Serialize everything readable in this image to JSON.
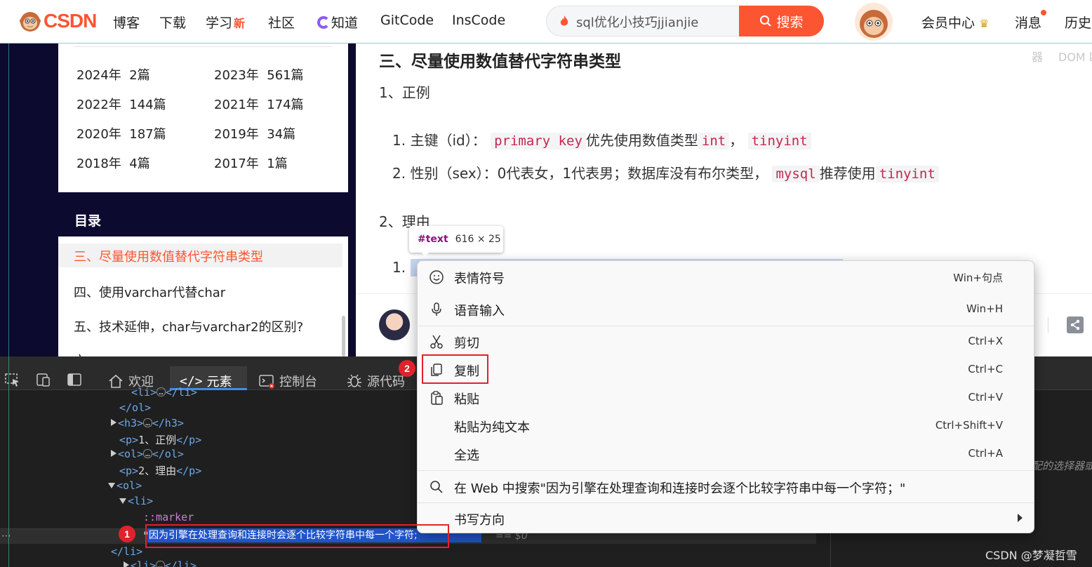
{
  "brand": {
    "logo_text": "CSDN"
  },
  "nav": {
    "items": [
      "博客",
      "下载",
      "学习",
      "社区",
      "知道",
      "GitCode",
      "InsCode"
    ],
    "new_badge": "新",
    "search_value": "sql优化小技巧jjianjie",
    "search_button": "搜索",
    "vip_center": "会员中心",
    "messages": "消息",
    "history": "历史"
  },
  "sidebar": {
    "archive": [
      {
        "year": "2024年",
        "count": "2篇"
      },
      {
        "year": "2023年",
        "count": "561篇"
      },
      {
        "year": "2022年",
        "count": "144篇"
      },
      {
        "year": "2021年",
        "count": "174篇"
      },
      {
        "year": "2020年",
        "count": "187篇"
      },
      {
        "year": "2019年",
        "count": "34篇"
      },
      {
        "year": "2018年",
        "count": "4篇"
      },
      {
        "year": "2017年",
        "count": "1篇"
      }
    ],
    "toc_title": "目录",
    "toc_items": [
      "三、尽量使用数值替代字符串类型",
      "四、使用varchar代替char",
      "五、技术延伸，char与varchar2的区别?",
      "六、..."
    ]
  },
  "article": {
    "heading": "三、尽量使用数值替代字符串类型",
    "p1": "1、正例",
    "li1": {
      "num": "1.",
      "pre": "主键（id）：",
      "code1": "primary key",
      "mid": "优先使用数值类型",
      "code2": "int",
      "sep": "，",
      "code3": "tinyint"
    },
    "li2": {
      "num": "2.",
      "pre": "性别（sex）：0代表女，1代表男；数据库没有布尔类型，",
      "code1": "mysql",
      "mid": "推荐使用",
      "code2": "tinyint"
    },
    "p2": "2、理由",
    "li3_num": "1."
  },
  "tooltip": {
    "tag": "#text",
    "dims": "616 × 25"
  },
  "context_menu": {
    "items": [
      {
        "label": "表情符号",
        "shortcut": "Win+句点"
      },
      {
        "label": "语音输入",
        "shortcut": "Win+H"
      },
      {
        "label": "剪切",
        "shortcut": "Ctrl+X"
      },
      {
        "label": "复制",
        "shortcut": "Ctrl+C"
      },
      {
        "label": "粘贴",
        "shortcut": "Ctrl+V"
      },
      {
        "label": "粘贴为纯文本",
        "shortcut": "Ctrl+Shift+V"
      },
      {
        "label": "全选",
        "shortcut": "Ctrl+A"
      },
      {
        "label": "在 Web 中搜索\"因为引擎在处理查询和连接时会逐个比较字符串中每一个字符；\"",
        "shortcut": ""
      },
      {
        "label": "书写方向",
        "shortcut": ""
      }
    ]
  },
  "devtools": {
    "tabs": [
      "欢迎",
      "元素",
      "控制台",
      "源代码"
    ],
    "dom_lines": {
      "ol_close": "</ol>",
      "h3": "<h3>",
      "h3_close": "</h3>",
      "p1_open": "<p>",
      "p1_text": "1、正例",
      "p1_close": "</p>",
      "ol2": "<ol>",
      "ol2_close": "</ol>",
      "p2_open": "<p>",
      "p2_text": "2、理由",
      "p2_close": "</p>",
      "ol3": "<ol>",
      "li": "<li>",
      "marker": "::marker",
      "selected_text": "因为引擎在处理查询和连接时会逐个比较字符串中每一个字符;",
      "eq_dollar": "== $0",
      "li_close": "</li>",
      "li_next": "<li>",
      "li_next_close": "</li>"
    },
    "right_tab_partial": "器",
    "right_tab_dom": "DOM 断",
    "right_filter": "配的选择器或",
    "ellipsis": "…",
    "quote": "\""
  },
  "annotations": {
    "step1": "1",
    "step2": "2"
  },
  "watermark": "CSDN @梦凝哲雪",
  "colors": {
    "brand": "#fc5531",
    "devtools_bg": "#1f1f1f",
    "selection": "#1f54c9",
    "annotation_red": "#e0232b"
  }
}
